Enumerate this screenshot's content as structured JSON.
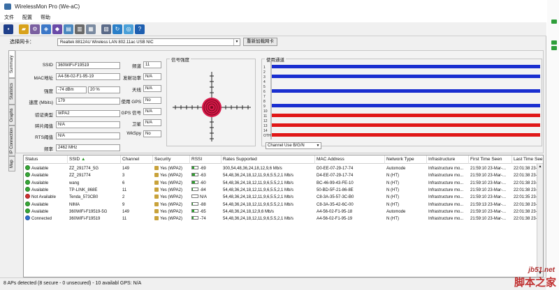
{
  "window": {
    "title": "WirelessMon Pro (We-aC)"
  },
  "menu": {
    "items": [
      "文件",
      "配置",
      "帮助"
    ]
  },
  "toolbar": {
    "buttons": [
      {
        "icon": "save-icon",
        "color": "#1f3f8a"
      },
      {
        "icon": "open-folder-icon",
        "color": "#d8a21a"
      },
      {
        "icon": "settings-icon",
        "color": "#7a5fa0"
      },
      {
        "icon": "network-icon",
        "color": "#3c78c8"
      },
      {
        "icon": "users-icon",
        "color": "#6a4aa8"
      },
      {
        "icon": "export-icon",
        "color": "#4a88c0"
      },
      {
        "icon": "print-icon",
        "color": "#6a6a6a"
      },
      {
        "icon": "log-icon",
        "color": "#7a8aa0"
      },
      {
        "icon": "report-icon",
        "color": "#5a6a88"
      },
      {
        "icon": "refresh-icon",
        "color": "#2a7fc8"
      },
      {
        "icon": "web-icon",
        "color": "#4aa0d8"
      },
      {
        "icon": "help-icon",
        "color": "#1e5fb0"
      }
    ]
  },
  "adapter": {
    "label": "选择网卡：",
    "value": "Realtek 8812AU Wireless LAN 802.11ac USB NIC",
    "rename_label": "重新加载网卡"
  },
  "tabs": [
    "Summary",
    "Statistics",
    "Graphs",
    "IP Connection",
    "Map"
  ],
  "summary": {
    "ssid_label": "SSID",
    "ssid": "360WiFi-F19519",
    "mac_label": "MAC地址",
    "mac": "A4-56-02-F1-95-19",
    "strength_label": "强度",
    "strength_dbm": "-74 dBm",
    "strength_pct": "20 %",
    "speed_label": "速度 (Mbits)",
    "speed": "179",
    "auth_label": "验证类型",
    "auth": "WPA2",
    "frag_label": "碎片阈值",
    "frag": "N/A",
    "rts_label": "RTS阈值",
    "rts": "N/A",
    "freq_label": "频率",
    "freq": "2462 MHz",
    "channel_label": "频道",
    "channel": "11",
    "txpower_label": "发射功率",
    "txpower": "N/A",
    "antenna_label": "天线",
    "antenna": "N/A",
    "gps_label": "使用 GPS",
    "gps": "No",
    "gps_signal_label": "GPS 信号",
    "gps_signal": "N/A",
    "satellites_label": "卫星",
    "satellites": "N/A",
    "wkspy_label": "WkSpy",
    "wkspy": "No"
  },
  "signal": {
    "title": "信号强度"
  },
  "channels": {
    "title": "使用通道",
    "labels": [
      "1",
      "2",
      "3",
      "4",
      "5",
      "6",
      "7",
      "8",
      "9",
      "10",
      "11",
      "12",
      "13",
      "14",
      "OTH"
    ],
    "usage": [
      {
        "channel": 1,
        "color": "blue"
      },
      {
        "channel": 3,
        "color": "blue"
      },
      {
        "channel": 6,
        "color": "blue"
      },
      {
        "channel": 9,
        "color": "blue"
      },
      {
        "channel": 11,
        "color": "red"
      },
      {
        "channel": 13,
        "color": "red"
      },
      {
        "channel": "OTH",
        "color": "red"
      }
    ],
    "selector": "Channel Use B/G/N"
  },
  "table": {
    "columns": [
      "Status",
      "SSID",
      "Channel",
      "Security",
      "RSSI",
      "Rates Supported",
      "MAC Address",
      "Network Type",
      "Infrastructure",
      "First Time Seen",
      "Last Time See"
    ],
    "rows": [
      {
        "status": "Available",
        "dot": "#36a836",
        "ssid": "ZZ_291774_5G",
        "channel": "149",
        "security": "Yes (WPA2)",
        "rssi": "-69",
        "rssi_level": 0.35,
        "rates": "300,54,48,36,24,18,12,9,6 Mb/s",
        "mac": "D0-EE-07-29-17-74",
        "type": "Automode",
        "infra": "Infrastructure mo...",
        "first": "21:59:10 23-Mar-...",
        "last": "22:01:38 23-Ma"
      },
      {
        "status": "Available",
        "dot": "#36a836",
        "ssid": "ZZ_291774",
        "channel": "3",
        "security": "Yes (WPA2)",
        "rssi": "-63",
        "rssi_level": 0.45,
        "rates": "54,48,36,24,18,12,11,9,6,5.5,2,1 Mb/s",
        "mac": "D4-EE-07-29-17-74",
        "type": "N (HT)",
        "infra": "Infrastructure mo...",
        "first": "21:59:10 23-Mar-...",
        "last": "22:01:38 23-Ma"
      },
      {
        "status": "Available",
        "dot": "#36a836",
        "ssid": "wang",
        "channel": "6",
        "security": "Yes (WPA2)",
        "rssi": "-60",
        "rssi_level": 0.5,
        "rates": "54,48,36,24,18,12,11,9,6,5.5,2,1 Mb/s",
        "mac": "BC-46-99-43-FE-10",
        "type": "N (HT)",
        "infra": "Infrastructure mo...",
        "first": "21:59:10 23-Mar-...",
        "last": "22:01:38 23-Ma"
      },
      {
        "status": "Available",
        "dot": "#36a836",
        "ssid": "TP-LINK_868E",
        "channel": "11",
        "security": "Yes (WPA2)",
        "rssi": "-84",
        "rssi_level": 0.1,
        "rates": "54,48,36,24,18,12,11,9,6,5.5,2,1 Mb/s",
        "mac": "50-BD-5F-21-86-8E",
        "type": "N (HT)",
        "infra": "Infrastructure mo...",
        "first": "21:59:10 23-Mar-...",
        "last": "22:01:38 23-Ma"
      },
      {
        "status": "Not Available",
        "dot": "#d03030",
        "ssid": "Tenda_573CB0",
        "channel": "2",
        "security": "Yes (WPA2)",
        "rssi": "N/A",
        "rssi_level": 0,
        "rates": "54,48,36,24,18,12,11,9,6,5.5,2,1 Mb/s",
        "mac": "C8-3A-35-57-3C-B0",
        "type": "N (HT)",
        "infra": "Infrastructure mo...",
        "first": "21:59:10 23-Mar-...",
        "last": "22:01:35 23-Ma"
      },
      {
        "status": "Available",
        "dot": "#36a836",
        "ssid": "NIMA",
        "channel": "9",
        "security": "Yes (WPA2)",
        "rssi": "-88",
        "rssi_level": 0.05,
        "rates": "54,48,36,24,18,12,11,9,6,5.5,2,1 Mb/s",
        "mac": "C8-3A-35-42-6C-00",
        "type": "N (HT)",
        "infra": "Infrastructure mo...",
        "first": "21:59:13 23-Mar-...",
        "last": "22:01:38 23-Ma"
      },
      {
        "status": "Available",
        "dot": "#36a836",
        "ssid": "360WiFi-F19519-5G",
        "channel": "149",
        "security": "Yes (WPA2)",
        "rssi": "-65",
        "rssi_level": 0.4,
        "rates": "54,48,36,24,18,12,9,6 Mb/s",
        "mac": "A4-56-02-F1-95-18",
        "type": "Automode",
        "infra": "Infrastructure mo...",
        "first": "21:59:10 23-Mar-...",
        "last": "22:01:38 23-Ma"
      },
      {
        "status": "Connected",
        "dot": "#2e6fd0",
        "ssid": "360WiFi-F19519",
        "channel": "11",
        "security": "Yes (WPA2)",
        "rssi": "-74",
        "rssi_level": 0.25,
        "rates": "54,48,36,24,18,12,11,9,6,5.5,2,1 Mb/s",
        "mac": "A4-56-02-F1-95-19",
        "type": "N (HT)",
        "infra": "Infrastructure mo...",
        "first": "21:59:10 23-Mar-...",
        "last": "22:01:38 23-Ma"
      }
    ]
  },
  "statusbar": {
    "text": "8 APs detected (8 secure - 0 unsecured) - 10 availabl GPS: N/A"
  },
  "watermark": {
    "site": "jb51.net",
    "text": "脚本之家"
  }
}
